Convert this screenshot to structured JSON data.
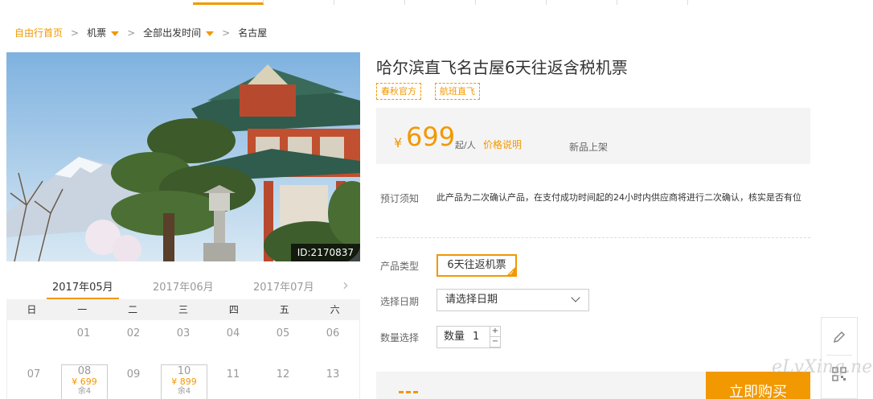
{
  "breadcrumb": {
    "home": "自由行首页",
    "sep": ">",
    "category": "机票",
    "departure": "全部出发时间",
    "destination": "名古屋"
  },
  "product": {
    "image_id": "ID:2170837",
    "title": "哈尔滨直飞名古屋6天往返含税机票",
    "tags": [
      "春秋官方",
      "航班直飞"
    ],
    "currency": "¥",
    "price": "699",
    "price_unit": "起/人",
    "price_explain": "价格说明",
    "status": "新品上架",
    "notice_label": "预订须知",
    "notice_text": "此产品为二次确认产品，在支付成功时间起的24小时内供应商将进行二次确认，核实是否有位",
    "type_label": "产品类型",
    "type_value": "6天往返机票",
    "date_label": "选择日期",
    "date_placeholder": "请选择日期",
    "qty_label": "数量选择",
    "qty_inner_label": "数量",
    "qty_value": "1",
    "qty_plus": "+",
    "qty_minus": "−",
    "buy_label": "立即购买"
  },
  "calendar": {
    "months": [
      "2017年05月",
      "2017年06月",
      "2017年07月"
    ],
    "next_icon": "chevron-right-icon",
    "weekdays": [
      "日",
      "一",
      "二",
      "三",
      "四",
      "五",
      "六"
    ],
    "week1": [
      "01",
      "02",
      "03",
      "04",
      "05",
      "06"
    ],
    "week2": [
      {
        "day": "07"
      },
      {
        "day": "08",
        "price": "¥ 699",
        "stock": "余4"
      },
      {
        "day": "09"
      },
      {
        "day": "10",
        "price": "¥ 899",
        "stock": "余4"
      },
      {
        "day": "11"
      },
      {
        "day": "12"
      },
      {
        "day": "13"
      }
    ]
  },
  "side_tools": [
    "pencil-icon",
    "qrcode-icon"
  ],
  "watermark": "eLvXing.net",
  "colors": {
    "accent": "#f29800",
    "panel": "#f4f4f4"
  }
}
